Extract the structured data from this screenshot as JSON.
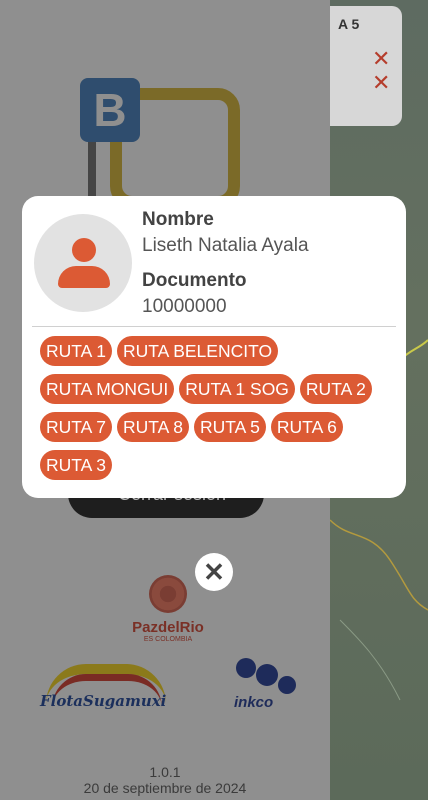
{
  "background": {
    "map_card_label": "A 5",
    "logout_label": "Cerrar sesión",
    "brand1": {
      "name": "PazdelRio",
      "sub": "ES COLOMBIA"
    },
    "brand2": {
      "name": "FlotaSugamuxi"
    },
    "brand3": {
      "name": "inkco"
    },
    "version": "1.0.1",
    "date": "20 de septiembre de 2024"
  },
  "profile": {
    "name_label": "Nombre",
    "name_value": "Liseth Natalia Ayala",
    "doc_label": "Documento",
    "doc_value": "10000000",
    "routes": [
      "RUTA 1",
      "RUTA BELENCITO",
      "RUTA MONGUI",
      "RUTA 1 SOG",
      "RUTA 2",
      "RUTA 7",
      "RUTA 8",
      "RUTA 5",
      "RUTA 6",
      "RUTA 3"
    ]
  },
  "close_icon": "close-icon",
  "colors": {
    "accent": "#dc5a34",
    "card": "#ffffff"
  }
}
